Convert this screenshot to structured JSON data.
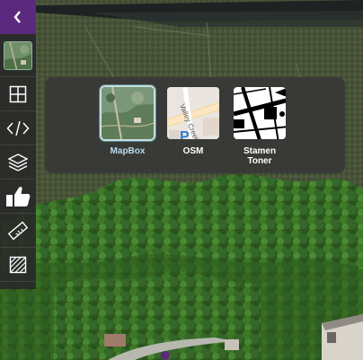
{
  "toolbar": {
    "collapse_icon": "chevron-left-icon",
    "buttons": [
      {
        "name": "base-layer-button",
        "icon": "base-layer-thumbnail"
      },
      {
        "name": "grid-button",
        "icon": "grid-icon"
      },
      {
        "name": "code-button",
        "icon": "code-icon"
      },
      {
        "name": "layers-button",
        "icon": "layers-icon"
      },
      {
        "name": "like-button",
        "icon": "thumbs-up-icon"
      },
      {
        "name": "measure-button",
        "icon": "ruler-icon"
      },
      {
        "name": "hatch-button",
        "icon": "hatch-icon"
      }
    ],
    "accent_color": "#5b2a7e"
  },
  "basemap_panel": {
    "options": [
      {
        "label": "MapBox",
        "selected": true
      },
      {
        "label": "OSM",
        "selected": false,
        "thumb_labels": {
          "street": "Valley Creek Blvd",
          "poi": "P"
        }
      },
      {
        "label": "Stamen\nToner",
        "label_line1": "Stamen",
        "label_line2": "Toner",
        "selected": false
      }
    ]
  },
  "colors": {
    "selected_label": "#b7dcf0",
    "panel_bg": "#373737"
  }
}
